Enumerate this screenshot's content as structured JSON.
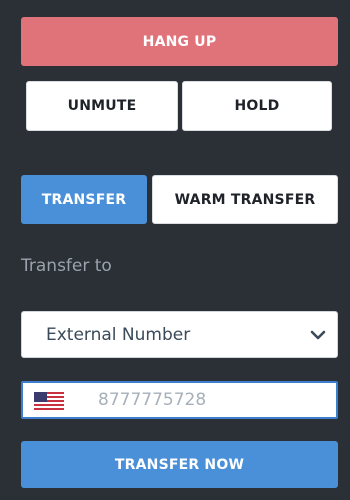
{
  "controls": {
    "hang_up_label": "HANG UP",
    "unmute_label": "UNMUTE",
    "hold_label": "HOLD"
  },
  "tabs": [
    {
      "label": "TRANSFER",
      "active": true
    },
    {
      "label": "WARM TRANSFER",
      "active": false
    }
  ],
  "transfer": {
    "label": "Transfer to",
    "destination_selected": "External Number",
    "country_flag": "us-flag-icon",
    "phone_value": "",
    "phone_placeholder": "8777775728",
    "submit_label": "TRANSFER NOW"
  },
  "colors": {
    "background": "#2b2f36",
    "hang_up": "#e0737a",
    "primary": "#4a90d9",
    "input_focus": "#3b7fcf"
  }
}
